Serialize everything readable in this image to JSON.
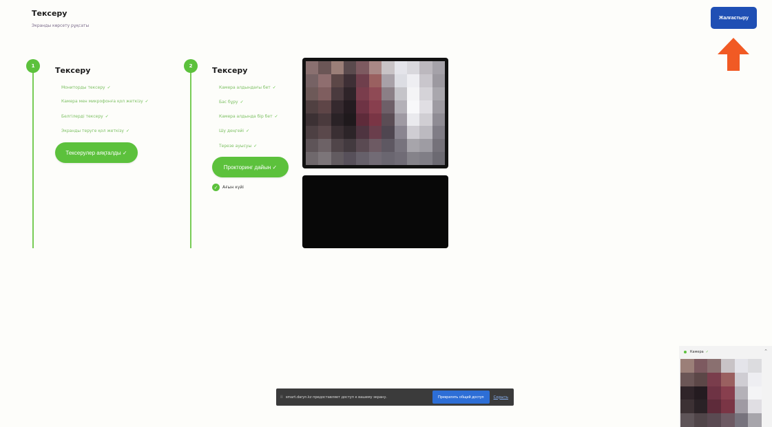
{
  "header": {
    "title": "Тексеру",
    "subtitle": "Экранды көрсету рұқсаты",
    "continue_label": "Жалғастыру"
  },
  "step1": {
    "number": "1",
    "title": "Тексеру",
    "items": [
      "Мониторды тексеру",
      "Камера мен микрофонға қол жеткізу",
      "Белгілерді тексеру",
      "Экранды теруге қол жеткізу"
    ],
    "button_label": "Тексерулер аяқталды ✓"
  },
  "step2": {
    "number": "2",
    "title": "Тексеру",
    "items": [
      "Камера алдындағы бет",
      "Бас бұру",
      "Камера алдында бір бет",
      "Шу деңгейі",
      "Терезе ауысуы"
    ],
    "button_label": "Прокторинг дайын ✓",
    "live_label": "Ағын күйі"
  },
  "share_bar": {
    "message": "smart.daryn.kz предоставляет доступ к вашему экрану.",
    "stop_label": "Прекратить общий доступ",
    "hide_label": "Скрыть"
  },
  "cam_widget": {
    "label": "Камера"
  },
  "colors": {
    "accent_green": "#5cc13c",
    "primary_blue": "#1f4fb4",
    "arrow": "#f15a24"
  },
  "icons": {
    "check": "check-icon",
    "arrow": "arrow-up-icon",
    "chevron": "chevron-up-icon"
  }
}
